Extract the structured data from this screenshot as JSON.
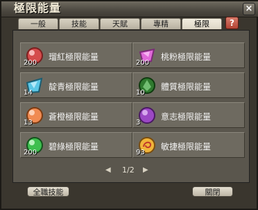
{
  "window": {
    "title": "極限能量",
    "close_label": "×"
  },
  "tabs": [
    "一般",
    "技能",
    "天賦",
    "專精",
    "極限"
  ],
  "active_tab": "極限",
  "help_label": "?",
  "items": [
    {
      "label": "瑠紅極限能量",
      "qty": "200",
      "color": "#e05a5a",
      "icon": "red-orb-icon"
    },
    {
      "label": "桃粉極限能量",
      "qty": "200",
      "color": "#e06ad9",
      "icon": "pink-crystal-icon"
    },
    {
      "label": "靛青極限能量",
      "qty": "14",
      "color": "#5cc7e6",
      "icon": "cyan-crystal-icon"
    },
    {
      "label": "體質極限能量",
      "qty": "10",
      "color": "#2f7a2f",
      "icon": "green-crest-icon"
    },
    {
      "label": "蒼橙極限能量",
      "qty": "13",
      "color": "#f08b52",
      "icon": "orange-orb-icon"
    },
    {
      "label": "意志極限能量",
      "qty": "3",
      "color": "#9b48c4",
      "icon": "purple-orb-icon"
    },
    {
      "label": "碧綠極限能量",
      "qty": "200",
      "color": "#3ebf4f",
      "icon": "green-orb-icon"
    },
    {
      "label": "敏捷極限能量",
      "qty": "93",
      "color": "#f0b43a",
      "icon": "gold-swirl-icon"
    }
  ],
  "pager": {
    "current_page": "1/2",
    "prev": "◀",
    "next": "▶"
  },
  "buttons": {
    "all_skills": "全職技能",
    "close": "關閉"
  }
}
